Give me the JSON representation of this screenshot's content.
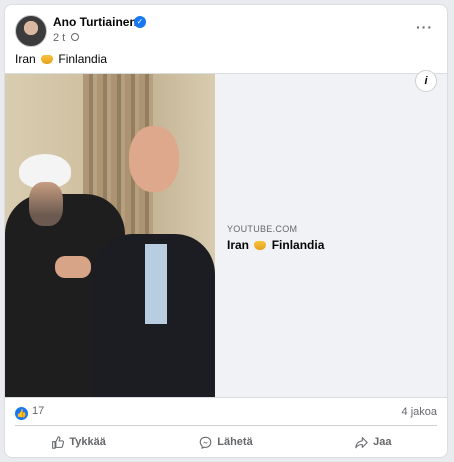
{
  "post": {
    "author": "Ano Turtiainen",
    "time": "2 t",
    "caption_left": "Iran",
    "caption_right": "Finlandia",
    "more": "···"
  },
  "link": {
    "domain": "YOUTUBE.COM",
    "title_left": "Iran",
    "title_right": "Finlandia",
    "info": "i"
  },
  "footer": {
    "reaction_count": "17",
    "shares": "4 jakoa",
    "like_label": "Tykkää",
    "comment_label": "Lähetä",
    "share_label": "Jaa"
  },
  "colors": {
    "accent": "#1877f2",
    "muted": "#65676b"
  },
  "icons": [
    "verified-icon",
    "globe-icon",
    "info-icon",
    "like-icon",
    "messenger-icon",
    "share-icon",
    "handshake-emoji"
  ]
}
